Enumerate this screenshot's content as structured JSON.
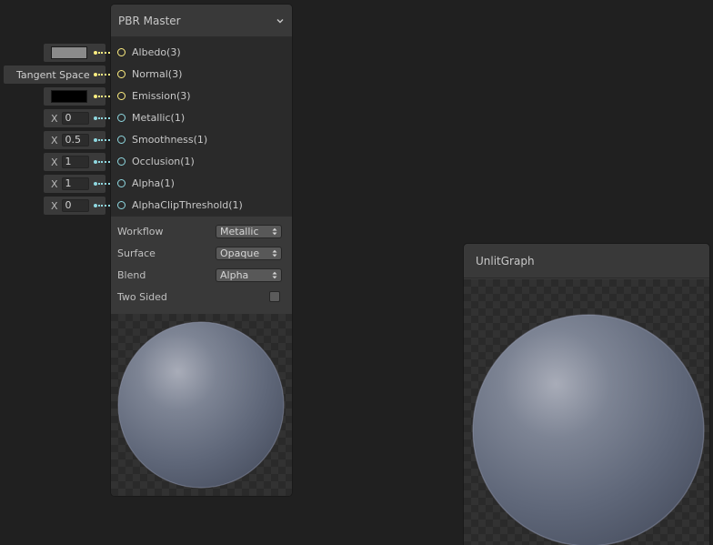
{
  "master_node": {
    "title": "PBR Master",
    "ports": [
      {
        "label": "Albedo(3)",
        "kind": "vector3"
      },
      {
        "label": "Normal(3)",
        "kind": "vector3"
      },
      {
        "label": "Emission(3)",
        "kind": "vector3"
      },
      {
        "label": "Metallic(1)",
        "kind": "float"
      },
      {
        "label": "Smoothness(1)",
        "kind": "float"
      },
      {
        "label": "Occlusion(1)",
        "kind": "float"
      },
      {
        "label": "Alpha(1)",
        "kind": "float"
      },
      {
        "label": "AlphaClipThreshold(1)",
        "kind": "float"
      }
    ],
    "settings": {
      "workflow": {
        "label": "Workflow",
        "value": "Metallic"
      },
      "surface": {
        "label": "Surface",
        "value": "Opaque"
      },
      "blend": {
        "label": "Blend",
        "value": "Alpha"
      },
      "two_sided": {
        "label": "Two Sided",
        "checked": false
      }
    }
  },
  "inputs": {
    "albedo_color": "#8a8a8a",
    "normal_space": "Tangent Space",
    "emission_color": "#000000",
    "metallic": {
      "axis": "X",
      "value": "0"
    },
    "smoothness": {
      "axis": "X",
      "value": "0.5"
    },
    "occlusion": {
      "axis": "X",
      "value": "1"
    },
    "alpha": {
      "axis": "X",
      "value": "1"
    },
    "alpha_clip_threshold": {
      "axis": "X",
      "value": "0"
    }
  },
  "unlit_node": {
    "title": "UnlitGraph"
  },
  "colors": {
    "vector3_port": "#ffee80",
    "float_port": "#8fd8e0",
    "background": "#202020",
    "node": "#393939"
  },
  "icons": {
    "collapse": "chevron-down-icon",
    "dropdown": "updown-arrows-icon",
    "port": "port-circle-icon"
  }
}
